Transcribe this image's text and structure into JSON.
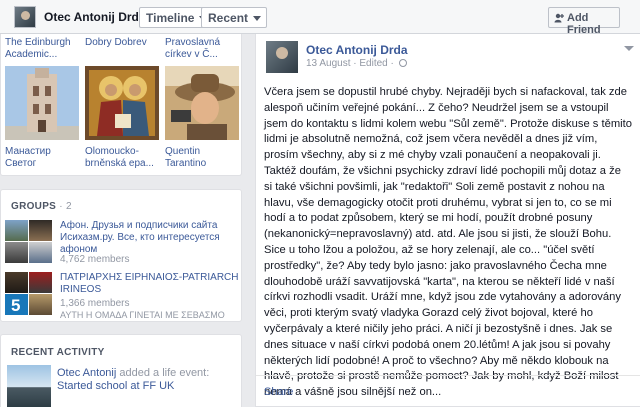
{
  "topbar": {
    "name": "Otec Antonij Drda",
    "timeline_label": "Timeline",
    "recent_label": "Recent",
    "add_friend_label": "Add Friend"
  },
  "likes": [
    {
      "top_label": "The Edinburgh Academic...",
      "caption": "Манастир Светог"
    },
    {
      "top_label": "Dobry Dobrev",
      "caption": "Olomoucko-brněnská epa..."
    },
    {
      "top_label": "Pravoslavná církev v Č...",
      "caption": "Quentin Tarantino"
    }
  ],
  "groups": {
    "title": "GROUPS",
    "count": "· 2",
    "items": [
      {
        "title": "Афон. Друзья и подписчики сайта Исихазм.ру. Все, кто интересуется афоном",
        "members": "4,762 members"
      },
      {
        "title": "ΠΑΤΡΙΑΡΧΗΣ ΕΙΡΗΝΑΙΟΣ-PATRIARCH IRINEOS",
        "members": "1,366 members",
        "subtext": "ΑΥΤΗ Η ΟΜΑΔΑ ΓΙΝΕΤΑΙ ΜΕ ΣΕΒΑΣΜΟ"
      }
    ]
  },
  "activity": {
    "title": "RECENT ACTIVITY",
    "actor": "Otec Antonij",
    "action": " added a life event: ",
    "event": "Started school at FF UK"
  },
  "post": {
    "author": "Otec Antonij Drda",
    "date": "13 August",
    "edited": " · Edited · ",
    "body": "Včera jsem se dopustil hrubé chyby. Nejraději bych si nafackoval, tak zde alespoň učiním veřejné pokání... Z čeho? Neudržel jsem se a vstoupil jsem do kontaktu s lidmi kolem webu \"Sůl země\". Protože diskuse s těmito lidmi je absolutně nemožná, což jsem včera nevěděl a dnes již vím, prosím všechny, aby si z mé chyby vzali ponaučení a neopakovali ji. Taktéž doufám, že všichni psychicky zdraví lidé pochopili můj dotaz a že si také všichni povšimli, jak \"redaktoři\" Soli země postavit z nohou na hlavu, vše demagogicky otočit proti druhému, vybrat si jen to, co se mi hodí a to podat způsobem, který se mi hodí, použít drobné posuny (nekanonický=nepravoslavný) atd. atd. Ale jsou si jisti, že slouží Bohu. Sice u toho lžou a polož​ou, až se hory zelenají, ale co... \"účel světí prostředky\", že? Aby tedy bylo jasno: jako pravoslavného Čecha mne dlouhodobě uráží savvatijovská \"karta\", na kterou se někteří lidé v naší církvi rozhodli vsadit. Uráží mne, když jsou zde vytahovány a adorovány věci, proti kterým svatý vladyka Gorazd celý život bojoval, které ho vyčerpávaly a které ničily jeho práci. A ničí ji bezostyšně i dnes. Jak se dnes situace v naší církvi podobá onem 20.létům! A jak jsou si povahy některých lidí podobné! A proč to všechno? Aby mě někdo klobouk na hlavě, protože si prostě nemůže pomoct? Jak by mohl, když Boží milost nemá a vášně jsou silnější než on...",
    "share_label": "Share"
  }
}
